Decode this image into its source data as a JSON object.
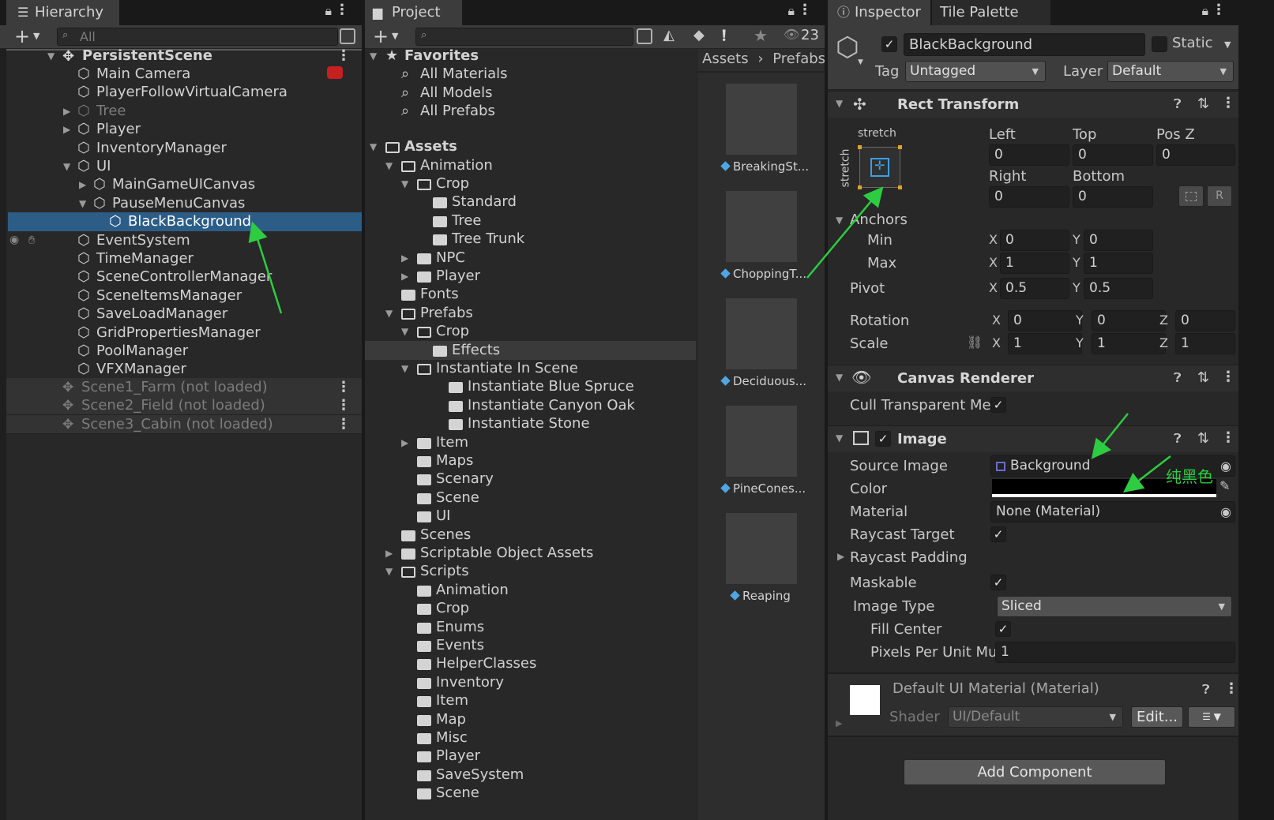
{
  "hierarchy": {
    "tab": "Hierarchy",
    "search_placeholder": "All",
    "scene": "PersistentScene",
    "items": [
      {
        "label": "Main Camera"
      },
      {
        "label": "PlayerFollowVirtualCamera"
      },
      {
        "label": "Tree"
      },
      {
        "label": "Player"
      },
      {
        "label": "InventoryManager"
      },
      {
        "label": "UI"
      },
      {
        "label": "MainGameUICanvas"
      },
      {
        "label": "PauseMenuCanvas"
      },
      {
        "label": "BlackBackground"
      },
      {
        "label": "EventSystem"
      },
      {
        "label": "TimeManager"
      },
      {
        "label": "SceneControllerManager"
      },
      {
        "label": "SceneItemsManager"
      },
      {
        "label": "SaveLoadManager"
      },
      {
        "label": "GridPropertiesManager"
      },
      {
        "label": "PoolManager"
      },
      {
        "label": "VFXManager"
      }
    ],
    "unloaded": [
      {
        "label": "Scene1_Farm (not loaded)"
      },
      {
        "label": "Scene2_Field (not loaded)"
      },
      {
        "label": "Scene3_Cabin (not loaded)"
      }
    ]
  },
  "project": {
    "tab": "Project",
    "hidden_count": "23",
    "breadcrumb": [
      "Assets",
      "Prefabs"
    ],
    "tree": [
      {
        "label": "Favorites"
      },
      {
        "label": "All Materials"
      },
      {
        "label": "All Models"
      },
      {
        "label": "All Prefabs"
      },
      {
        "label": "Assets"
      },
      {
        "label": "Animation"
      },
      {
        "label": "Crop"
      },
      {
        "label": "Standard"
      },
      {
        "label": "Tree"
      },
      {
        "label": "Tree Trunk"
      },
      {
        "label": "NPC"
      },
      {
        "label": "Player"
      },
      {
        "label": "Fonts"
      },
      {
        "label": "Prefabs"
      },
      {
        "label": "Crop"
      },
      {
        "label": "Effects"
      },
      {
        "label": "Instantiate In Scene"
      },
      {
        "label": "Instantiate Blue Spruce"
      },
      {
        "label": "Instantiate Canyon Oak"
      },
      {
        "label": "Instantiate Stone"
      },
      {
        "label": "Item"
      },
      {
        "label": "Maps"
      },
      {
        "label": "Scenary"
      },
      {
        "label": "Scene"
      },
      {
        "label": "UI"
      },
      {
        "label": "Scenes"
      },
      {
        "label": "Scriptable Object Assets"
      },
      {
        "label": "Scripts"
      },
      {
        "label": "Animation"
      },
      {
        "label": "Crop"
      },
      {
        "label": "Enums"
      },
      {
        "label": "Events"
      },
      {
        "label": "HelperClasses"
      },
      {
        "label": "Inventory"
      },
      {
        "label": "Item"
      },
      {
        "label": "Map"
      },
      {
        "label": "Misc"
      },
      {
        "label": "Player"
      },
      {
        "label": "SaveSystem"
      },
      {
        "label": "Scene"
      }
    ],
    "assets": [
      {
        "label": "BreakingSt..."
      },
      {
        "label": "ChoppingT..."
      },
      {
        "label": "Deciduous..."
      },
      {
        "label": "PineCones..."
      },
      {
        "label": "Reaping"
      }
    ]
  },
  "inspector": {
    "tabs": [
      "Inspector",
      "Tile Palette"
    ],
    "object_name": "BlackBackground",
    "static_label": "Static",
    "tag_label": "Tag",
    "tag_value": "Untagged",
    "layer_label": "Layer",
    "layer_value": "Default",
    "rect_transform": {
      "title": "Rect Transform",
      "stretch_h": "stretch",
      "stretch_v": "stretch",
      "labels": {
        "left": "Left",
        "top": "Top",
        "posz": "Pos Z",
        "right": "Right",
        "bottom": "Bottom"
      },
      "values": {
        "left": "0",
        "top": "0",
        "posz": "0",
        "right": "0",
        "bottom": "0"
      },
      "r_button": "R",
      "anchors_label": "Anchors",
      "min_label": "Min",
      "max_label": "Max",
      "pivot_label": "Pivot",
      "rotation_label": "Rotation",
      "scale_label": "Scale",
      "axis": {
        "x": "X",
        "y": "Y",
        "z": "Z"
      },
      "anchor_min": {
        "x": "0",
        "y": "0"
      },
      "anchor_max": {
        "x": "1",
        "y": "1"
      },
      "pivot": {
        "x": "0.5",
        "y": "0.5"
      },
      "rotation": {
        "x": "0",
        "y": "0",
        "z": "0"
      },
      "scale": {
        "x": "1",
        "y": "1",
        "z": "1"
      }
    },
    "canvas_renderer": {
      "title": "Canvas Renderer",
      "cull_label": "Cull Transparent Me"
    },
    "image": {
      "title": "Image",
      "source_label": "Source Image",
      "source_value": "Background",
      "color_label": "Color",
      "color_value": "#000000",
      "annotation": "纯黑色",
      "material_label": "Material",
      "material_value": "None (Material)",
      "raycast_target_label": "Raycast Target",
      "raycast_padding_label": "Raycast Padding",
      "maskable_label": "Maskable",
      "image_type_label": "Image Type",
      "image_type_value": "Sliced",
      "fill_center_label": "Fill Center",
      "ppu_label": "Pixels Per Unit Mu",
      "ppu_value": "1"
    },
    "material": {
      "title": "Default UI Material (Material)",
      "shader_label": "Shader",
      "shader_value": "UI/Default",
      "edit_label": "Edit..."
    },
    "add_component": "Add Component"
  },
  "colors": {
    "selection": "#2c5d87",
    "annotation_arrow": "#2ecc40",
    "panel": "#282828"
  }
}
